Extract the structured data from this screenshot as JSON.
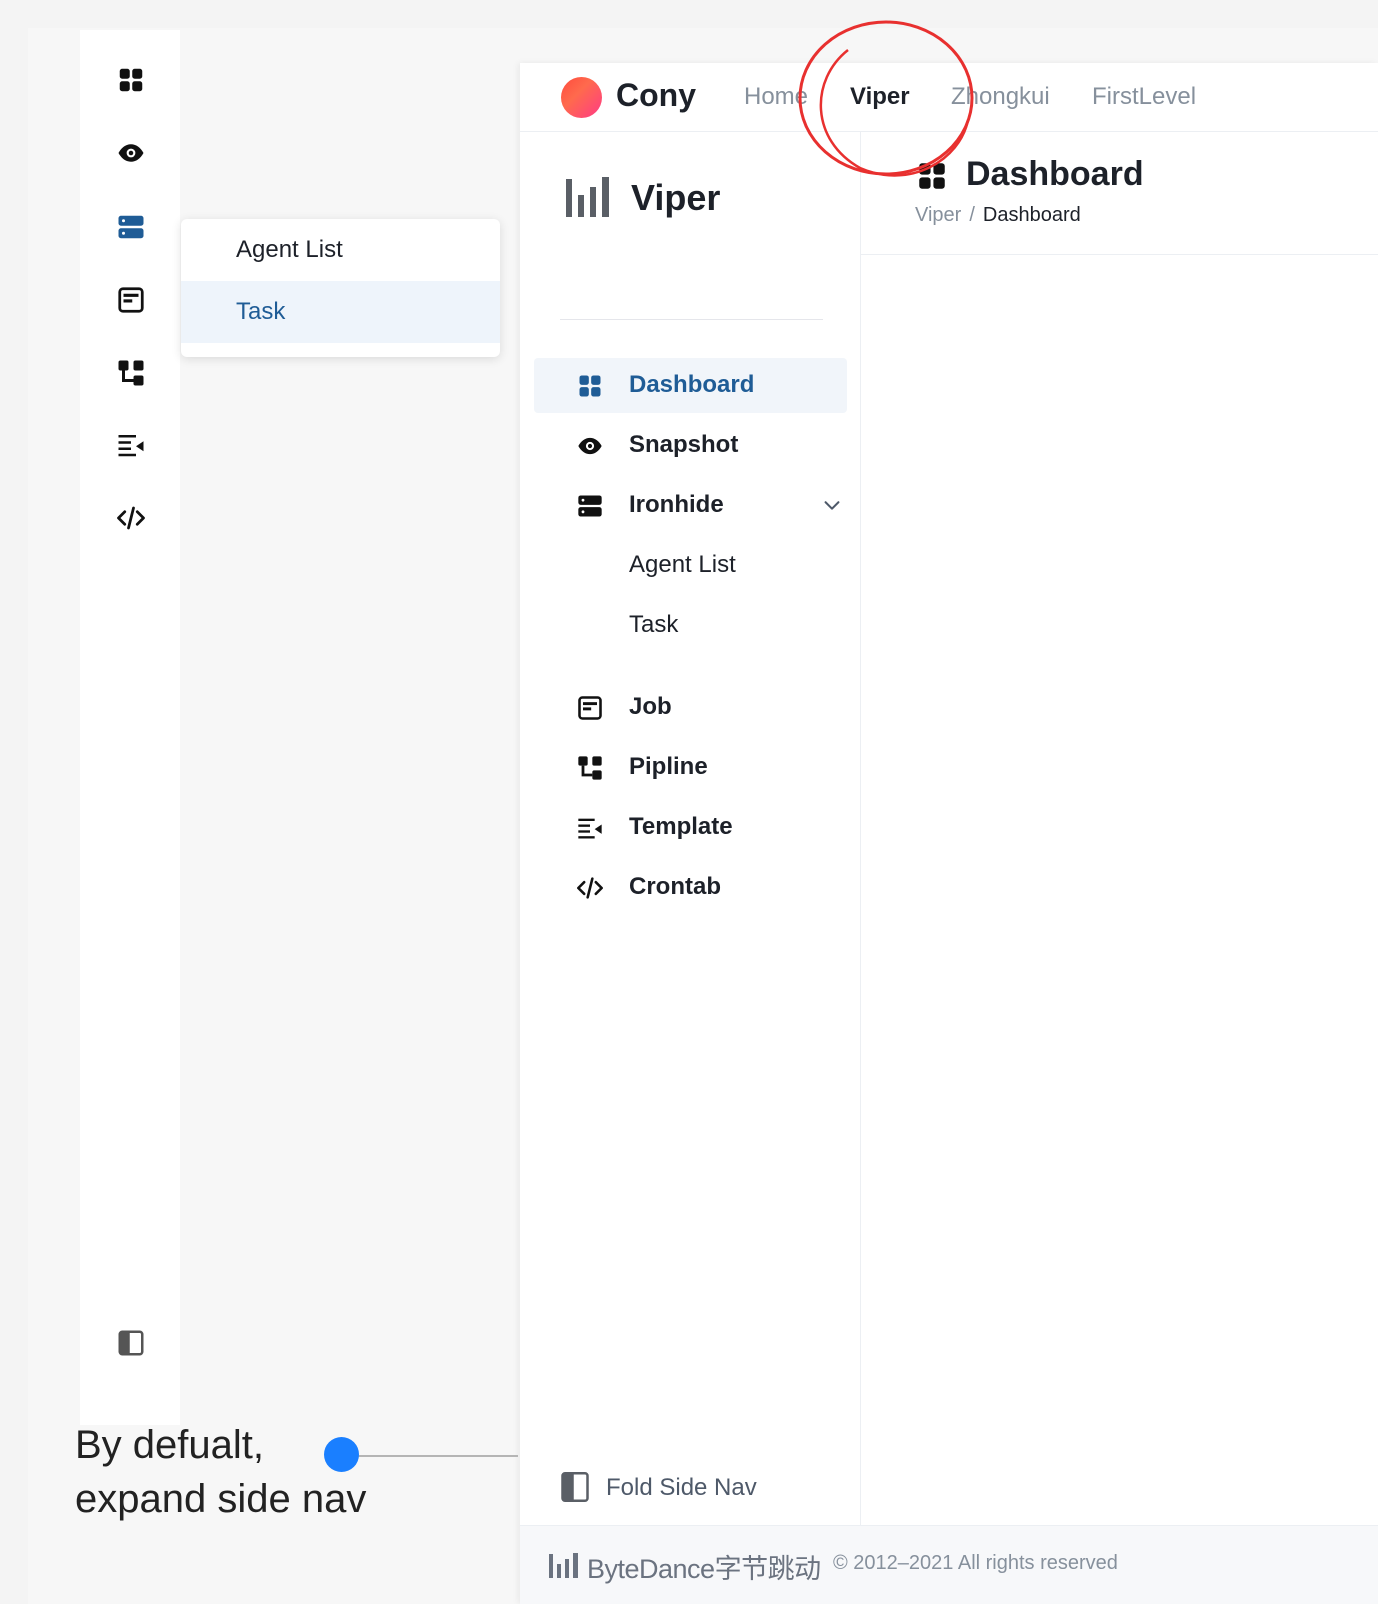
{
  "rail": {
    "icons": [
      "dashboard-icon",
      "eye-icon",
      "server-icon",
      "job-icon",
      "pipeline-icon",
      "template-icon",
      "code-icon",
      "fold-panel-icon"
    ]
  },
  "popover": {
    "items": [
      {
        "label": "Agent List",
        "active": false
      },
      {
        "label": "Task",
        "active": true
      }
    ]
  },
  "header": {
    "brand": "Cony",
    "nav": [
      {
        "label": "Home",
        "active": false
      },
      {
        "label": "Viper",
        "active": true
      },
      {
        "label": "Zhongkui",
        "active": false
      },
      {
        "label": "FirstLevel",
        "active": false
      }
    ]
  },
  "sidenav": {
    "app_name": "Viper",
    "items": [
      {
        "label": "Dashboard",
        "icon": "dashboard-icon",
        "active": true
      },
      {
        "label": "Snapshot",
        "icon": "eye-icon"
      },
      {
        "label": "Ironhide",
        "icon": "server-icon",
        "expanded": true
      },
      {
        "label": "Agent List"
      },
      {
        "label": "Task"
      },
      {
        "label": "Job",
        "icon": "job-icon"
      },
      {
        "label": "Pipline",
        "icon": "pipeline-icon"
      },
      {
        "label": "Template",
        "icon": "template-icon"
      },
      {
        "label": "Crontab",
        "icon": "code-icon"
      }
    ],
    "fold_label": "Fold Side Nav"
  },
  "content": {
    "title": "Dashboard",
    "breadcrumb": [
      "Viper",
      "/",
      "Dashboard"
    ]
  },
  "footer": {
    "brand": "ByteDance字节跳动",
    "copyright": "© 2012–2021 All rights reserved"
  },
  "annotation": {
    "line1": "By defualt,",
    "line2": "expand side nav"
  },
  "colors": {
    "accent": "#1f5c96",
    "annotation_dot": "#1a7fff",
    "highlight_circle": "#e8302f"
  }
}
